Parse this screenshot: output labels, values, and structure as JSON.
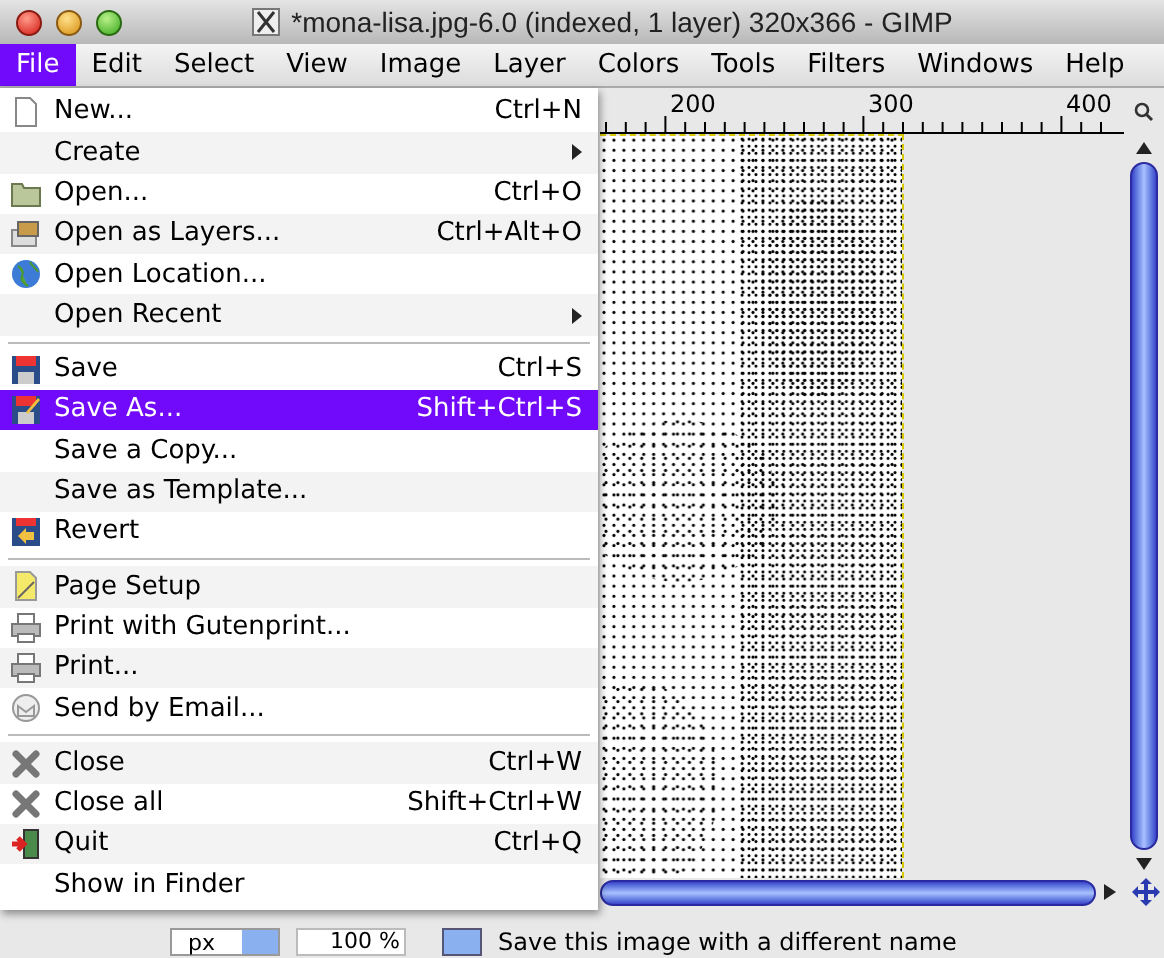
{
  "window": {
    "title": "*mona-lisa.jpg-6.0 (indexed, 1 layer) 320x366 - GIMP"
  },
  "menubar": [
    {
      "label": "File",
      "selected": true
    },
    {
      "label": "Edit",
      "selected": false
    },
    {
      "label": "Select",
      "selected": false
    },
    {
      "label": "View",
      "selected": false
    },
    {
      "label": "Image",
      "selected": false
    },
    {
      "label": "Layer",
      "selected": false
    },
    {
      "label": "Colors",
      "selected": false
    },
    {
      "label": "Tools",
      "selected": false
    },
    {
      "label": "Filters",
      "selected": false
    },
    {
      "label": "Windows",
      "selected": false
    },
    {
      "label": "Help",
      "selected": false
    }
  ],
  "file_menu": {
    "sections": [
      [
        {
          "label": "New...",
          "shortcut": "Ctrl+N",
          "submenu": false,
          "selected": false
        },
        {
          "label": "Create",
          "submenu": true,
          "selected": false
        },
        {
          "label": "Open...",
          "shortcut": "Ctrl+O",
          "submenu": false,
          "selected": false
        },
        {
          "label": "Open as Layers...",
          "shortcut": "Ctrl+Alt+O",
          "submenu": false,
          "selected": false
        },
        {
          "label": "Open Location...",
          "submenu": false,
          "selected": false
        },
        {
          "label": "Open Recent",
          "submenu": true,
          "selected": false
        }
      ],
      [
        {
          "label": "Save",
          "shortcut": "Ctrl+S",
          "submenu": false,
          "selected": false
        },
        {
          "label": "Save As...",
          "shortcut": "Shift+Ctrl+S",
          "submenu": false,
          "selected": true
        },
        {
          "label": "Save a Copy...",
          "submenu": false,
          "selected": false
        },
        {
          "label": "Save as Template...",
          "submenu": false,
          "selected": false
        },
        {
          "label": "Revert",
          "submenu": false,
          "selected": false
        }
      ],
      [
        {
          "label": "Page Setup",
          "submenu": false,
          "selected": false
        },
        {
          "label": "Print with Gutenprint...",
          "submenu": false,
          "selected": false
        },
        {
          "label": "Print...",
          "submenu": false,
          "selected": false
        },
        {
          "label": "Send by Email...",
          "submenu": false,
          "selected": false
        }
      ],
      [
        {
          "label": "Close",
          "shortcut": "Ctrl+W",
          "submenu": false,
          "selected": false
        },
        {
          "label": "Close all",
          "shortcut": "Shift+Ctrl+W",
          "submenu": false,
          "selected": false
        },
        {
          "label": "Quit",
          "shortcut": "Ctrl+Q",
          "submenu": false,
          "selected": false
        },
        {
          "label": "Show in Finder",
          "submenu": false,
          "selected": false
        }
      ]
    ]
  },
  "ruler": {
    "labels": [
      "200",
      "300",
      "400"
    ]
  },
  "status_bar": {
    "unit": "px",
    "zoom": "100 %",
    "message": "Save this image with a different name"
  }
}
